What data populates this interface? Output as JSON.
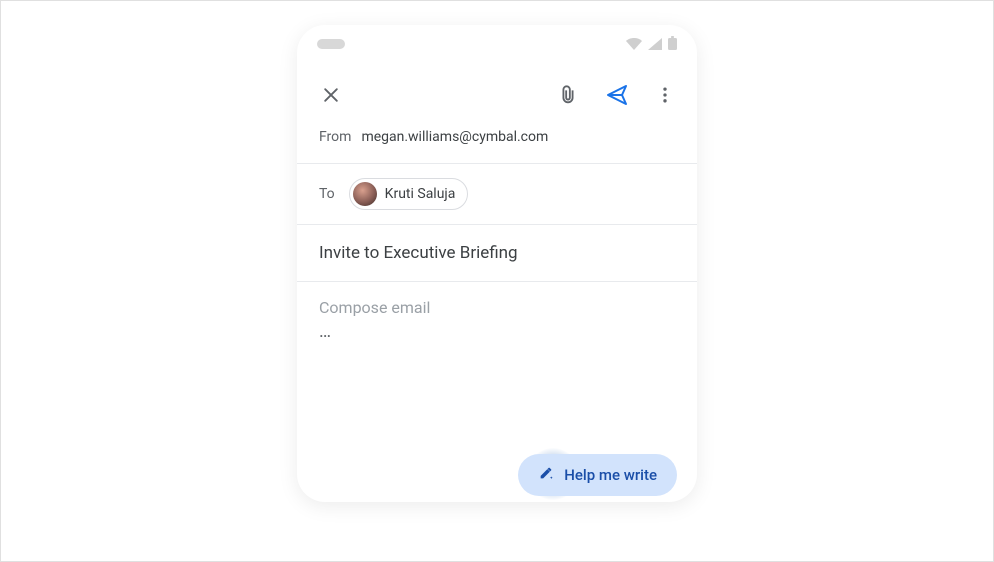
{
  "from": {
    "label": "From",
    "email": "megan.williams@cymbal.com"
  },
  "to": {
    "label": "To",
    "recipient_name": "Kruti Saluja"
  },
  "subject": "Invite to Executive Briefing",
  "body": {
    "placeholder": "Compose email",
    "ellipsis": "…"
  },
  "help_button": {
    "label": "Help me write"
  }
}
